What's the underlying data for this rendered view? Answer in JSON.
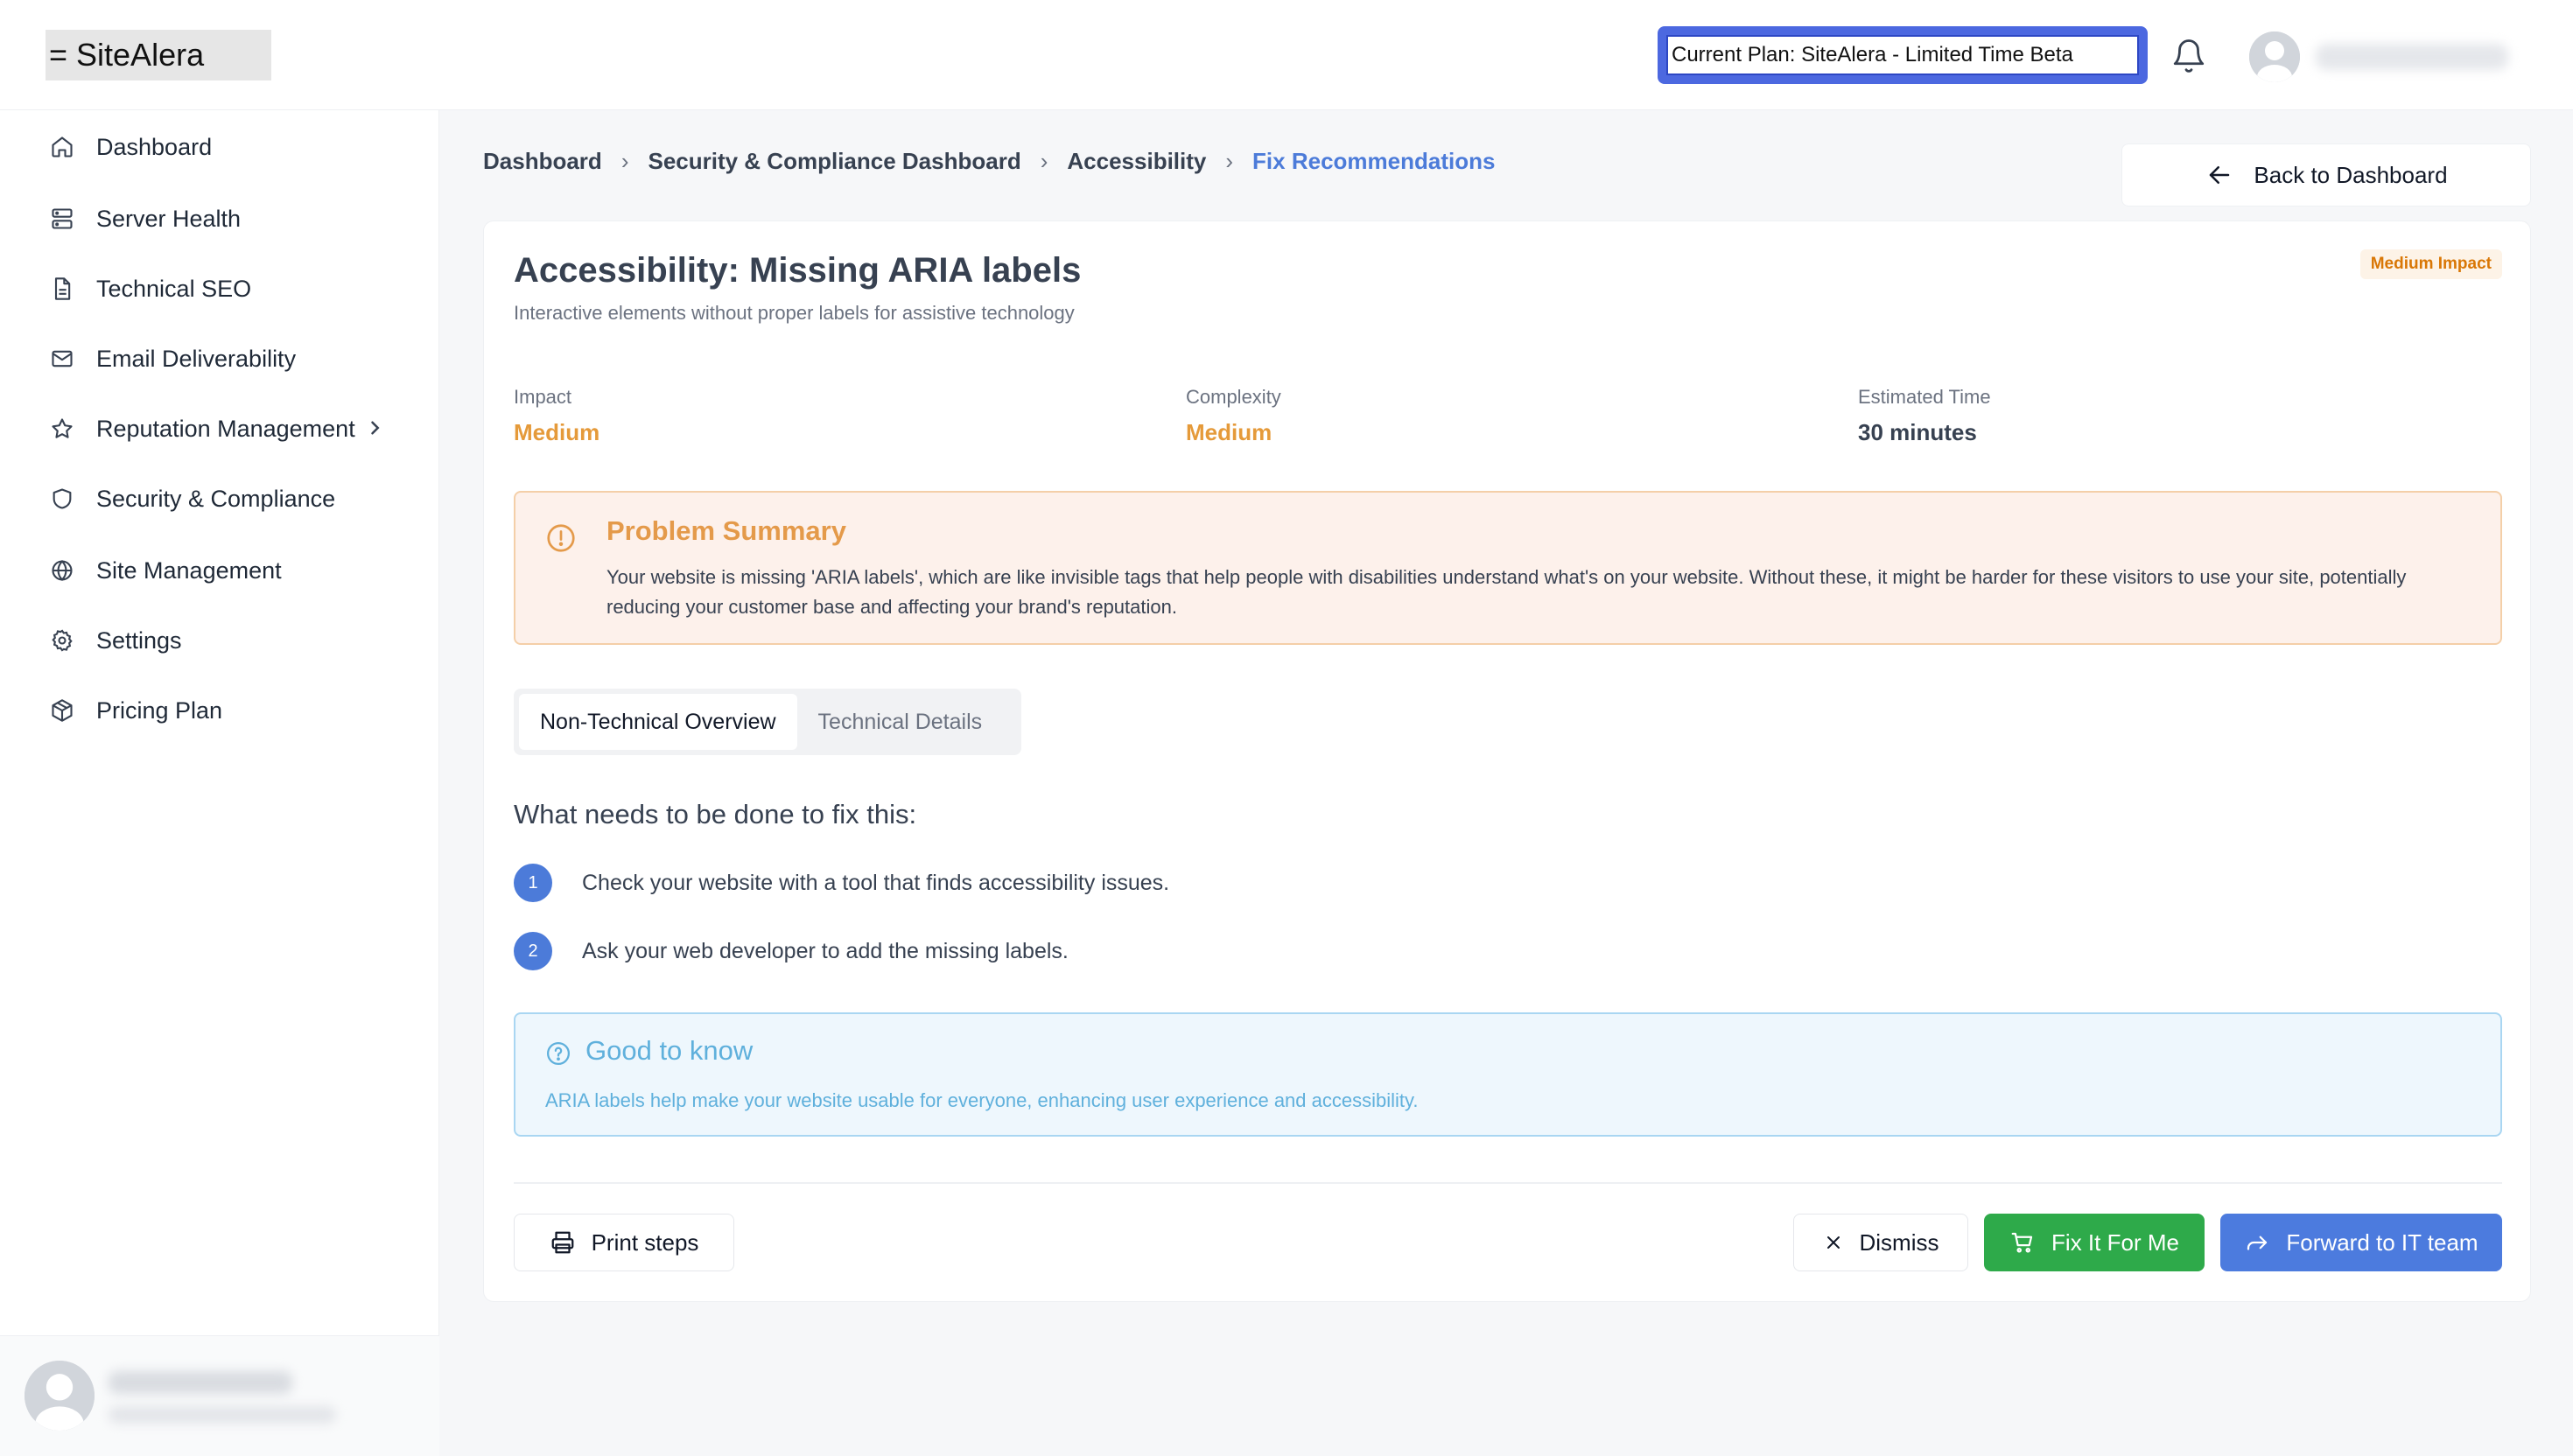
{
  "header": {
    "logo": "= SiteAlera",
    "plan": "Current Plan: SiteAlera - Limited Time Beta"
  },
  "sidebar": {
    "items": [
      {
        "label": "Dashboard",
        "icon": "home-icon"
      },
      {
        "label": "Server Health",
        "icon": "server-icon"
      },
      {
        "label": "Technical SEO",
        "icon": "document-icon"
      },
      {
        "label": "Email Deliverability",
        "icon": "mail-icon"
      },
      {
        "label": "Reputation Management",
        "icon": "star-icon"
      },
      {
        "label": "Security & Compliance",
        "icon": "shield-icon"
      },
      {
        "label": "Site Management",
        "icon": "globe-icon"
      },
      {
        "label": "Settings",
        "icon": "gear-icon"
      },
      {
        "label": "Pricing Plan",
        "icon": "package-icon"
      }
    ]
  },
  "breadcrumb": {
    "items": [
      "Dashboard",
      "Security & Compliance Dashboard",
      "Accessibility"
    ],
    "current": "Fix Recommendations"
  },
  "back_button": "Back to Dashboard",
  "card": {
    "title": "Accessibility: Missing ARIA labels",
    "subtitle": "Interactive elements without proper labels for assistive technology",
    "badge": "Medium Impact",
    "metrics": [
      {
        "label": "Impact",
        "value": "Medium"
      },
      {
        "label": "Complexity",
        "value": "Medium"
      },
      {
        "label": "Estimated Time",
        "value": "30 minutes"
      }
    ],
    "problem": {
      "title": "Problem Summary",
      "text": "Your website is missing 'ARIA labels', which are like invisible tags that help people with disabilities understand what's on your website. Without these, it might be harder for these visitors to use your site, potentially reducing your customer base and affecting your brand's reputation."
    },
    "tabs": [
      "Non-Technical Overview",
      "Technical Details"
    ],
    "section_heading": "What needs to be done to fix this:",
    "steps": [
      {
        "num": "1",
        "text": "Check your website with a tool that finds accessibility issues."
      },
      {
        "num": "2",
        "text": "Ask your web developer to add the missing labels."
      }
    ],
    "good_to_know": {
      "title": "Good to know",
      "text": "ARIA labels help make your website usable for everyone, enhancing user experience and accessibility."
    },
    "buttons": {
      "print": "Print steps",
      "dismiss": "Dismiss",
      "fix": "Fix It For Me",
      "forward": "Forward to IT team"
    }
  },
  "colors": {
    "accent": "#4c7bd9",
    "warning": "#e59a3a",
    "success": "#2eaa4a",
    "info": "#5fb0dc"
  }
}
